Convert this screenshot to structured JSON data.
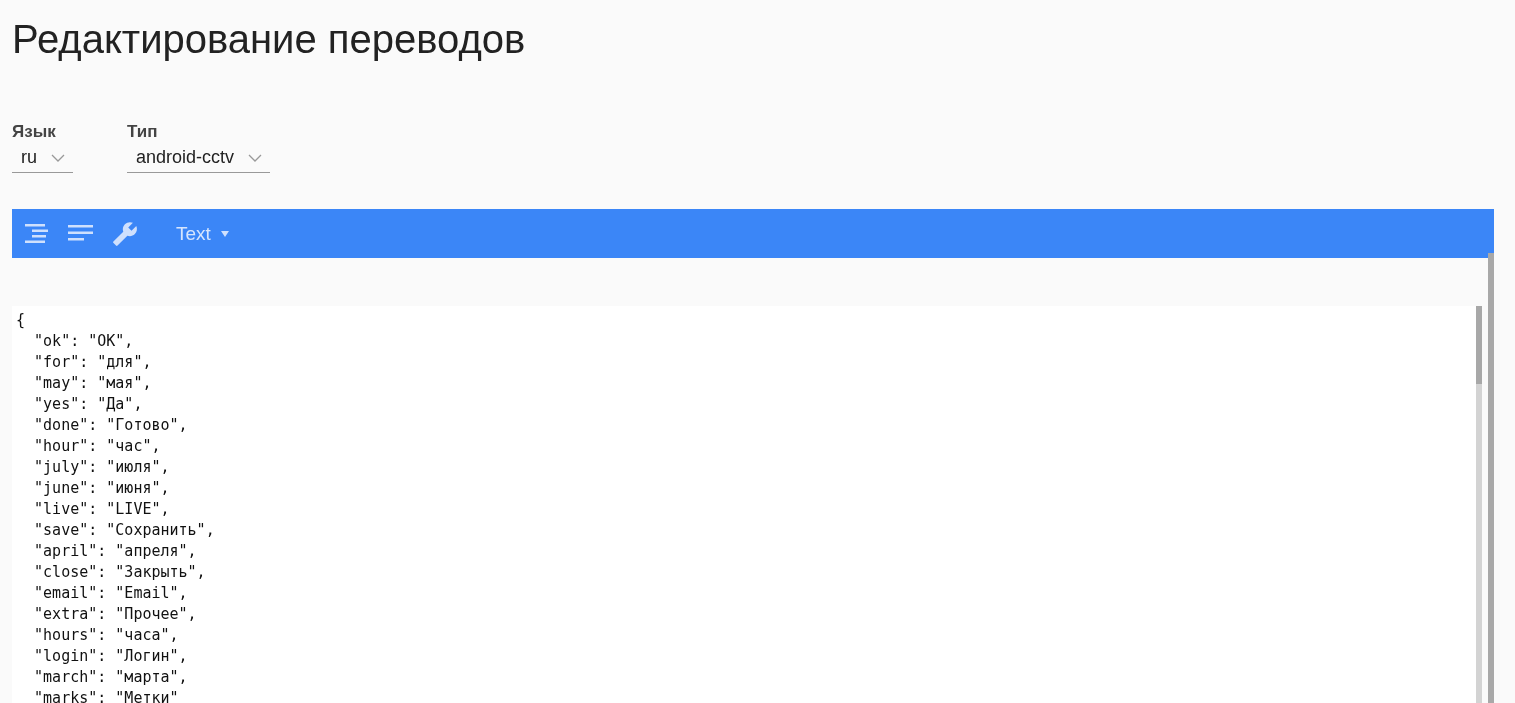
{
  "title": "Редактирование переводов",
  "filters": [
    {
      "label": "Язык",
      "value": "ru"
    },
    {
      "label": "Тип",
      "value": "android-cctv"
    }
  ],
  "toolbar": {
    "mode": "Text"
  },
  "editor": {
    "lines": [
      "{",
      "  \"ok\": \"OK\",",
      "  \"for\": \"для\",",
      "  \"may\": \"мая\",",
      "  \"yes\": \"Да\",",
      "  \"done\": \"Готово\",",
      "  \"hour\": \"час\",",
      "  \"july\": \"июля\",",
      "  \"june\": \"июня\",",
      "  \"live\": \"LIVE\",",
      "  \"save\": \"Сохранить\",",
      "  \"april\": \"апреля\",",
      "  \"close\": \"Закрыть\",",
      "  \"email\": \"Email\",",
      "  \"extra\": \"Прочее\",",
      "  \"hours\": \"часа\",",
      "  \"login\": \"Логин\",",
      "  \"march\": \"марта\",",
      "  \"marks\": \"Метки\""
    ]
  }
}
